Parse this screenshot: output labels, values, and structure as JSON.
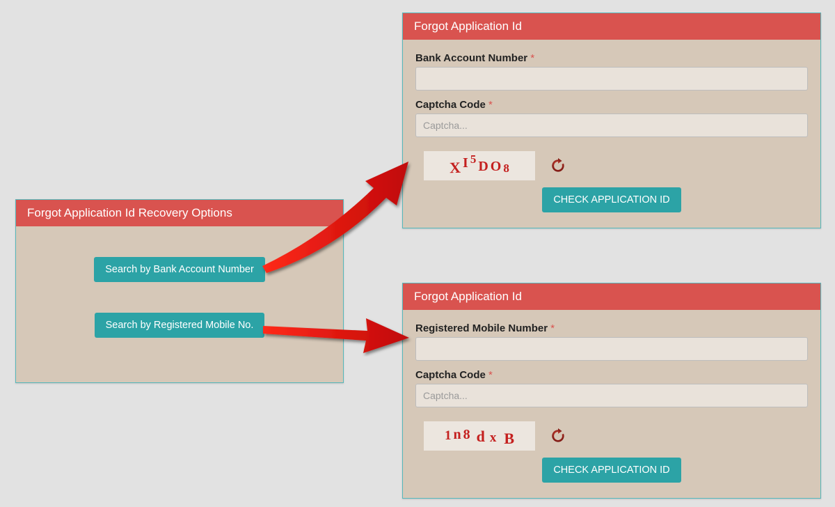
{
  "left_panel": {
    "title": "Forgot Application Id Recovery Options",
    "btn_bank": "Search by Bank Account Number",
    "btn_mobile": "Search by Registered Mobile No."
  },
  "panel_bank": {
    "title": "Forgot Application Id",
    "field_label": "Bank Account Number",
    "captcha_label": "Captcha Code",
    "captcha_placeholder": "Captcha...",
    "captcha_chars": [
      "X",
      "I",
      "5",
      "D",
      "O",
      "8"
    ],
    "submit": "CHECK APPLICATION ID"
  },
  "panel_mobile": {
    "title": "Forgot Application Id",
    "field_label": "Registered Mobile Number",
    "captcha_label": "Captcha Code",
    "captcha_placeholder": "Captcha...",
    "captcha_chars": [
      "1",
      "n",
      "8",
      "d",
      "x",
      "B"
    ],
    "submit": "CHECK APPLICATION ID"
  },
  "required_marker": "*"
}
